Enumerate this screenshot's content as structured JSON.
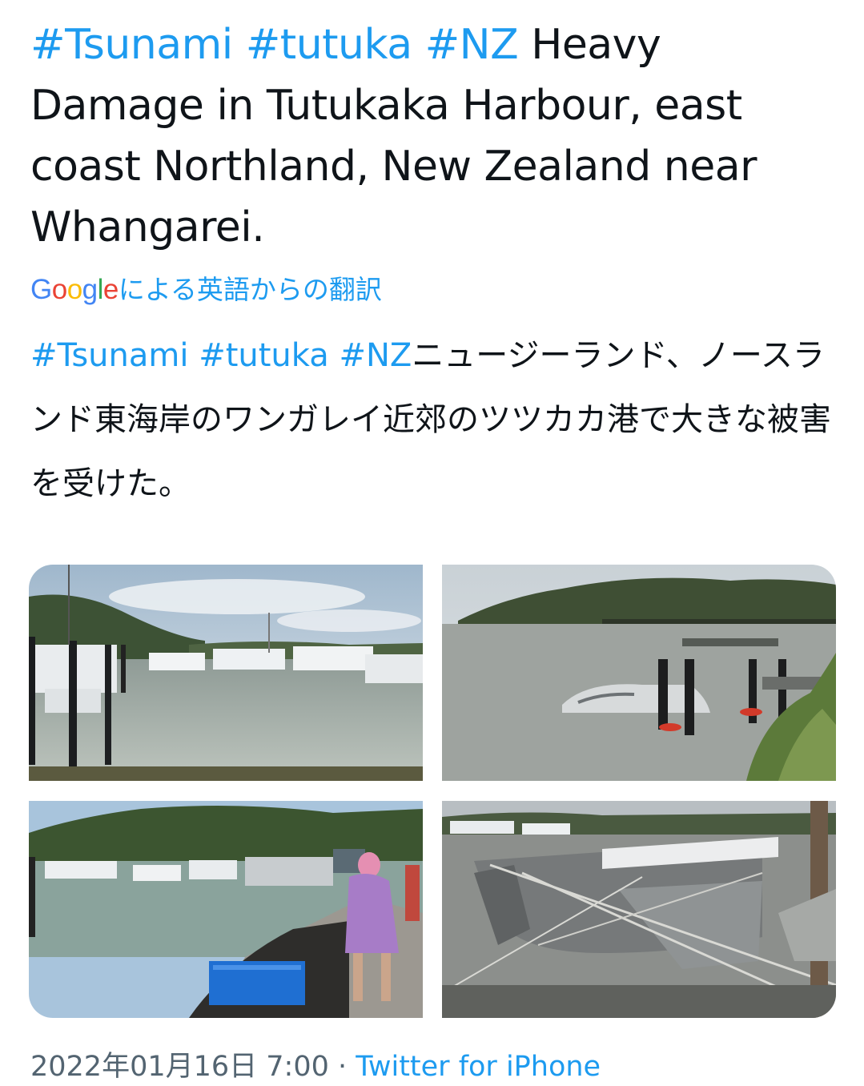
{
  "tweet": {
    "hashtags": [
      "#Tsunami",
      "#tutuka",
      "#NZ"
    ],
    "text": " Heavy Damage in Tutukaka Harbour, east coast Northland, New Zealand near Whangarei."
  },
  "translation": {
    "google_letters": [
      "G",
      "o",
      "o",
      "g",
      "l",
      "e"
    ],
    "label": "による英語からの翻訳",
    "hashtags": [
      "#Tsunami",
      "#tutuka",
      "#NZ"
    ],
    "text": "ニュージーランド、ノースランド東海岸のワンガレイ近郊のツツカカ港で大きな被害を受けた。"
  },
  "media": {
    "photos": [
      {
        "name": "marina-boats-photo"
      },
      {
        "name": "sunken-boat-photo"
      },
      {
        "name": "people-on-shore-photo"
      },
      {
        "name": "damaged-catamaran-photo"
      }
    ]
  },
  "meta": {
    "timestamp": "2022年01月16日 7:00",
    "separator": " · ",
    "source": "Twitter for iPhone"
  },
  "colors": {
    "link": "#1d9bf0",
    "text": "#0f1419",
    "muted": "#536471"
  }
}
